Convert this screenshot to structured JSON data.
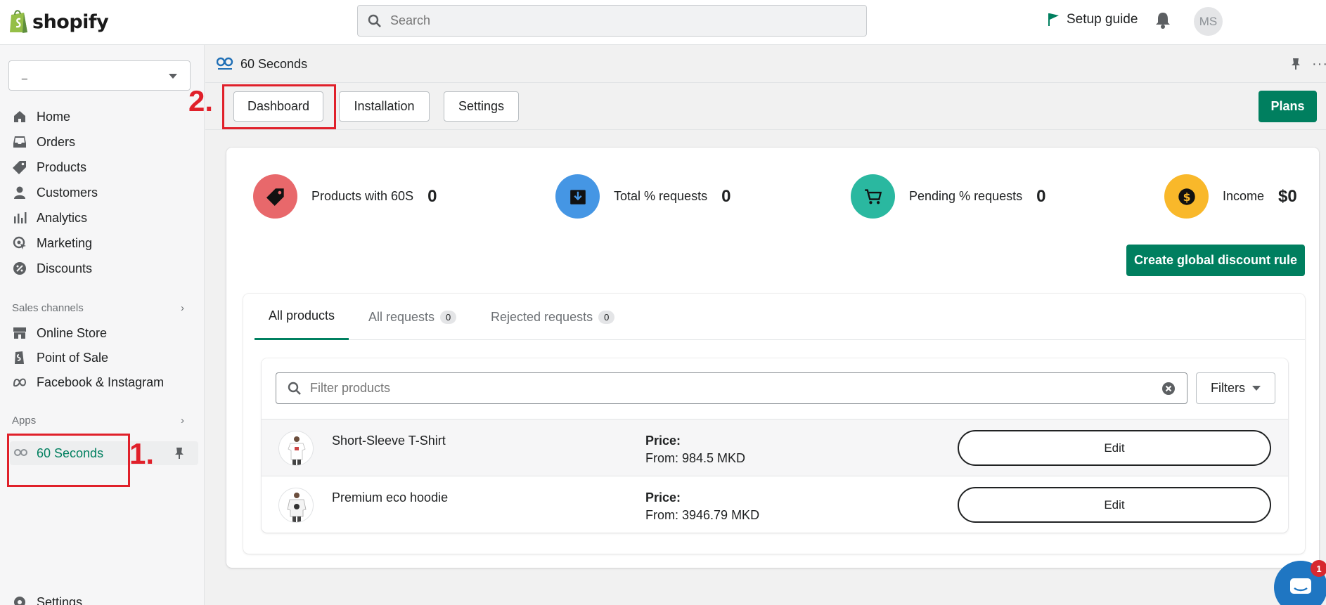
{
  "topbar": {
    "logo_text": "shopify",
    "search_placeholder": "Search",
    "setup_guide": "Setup guide",
    "avatar_initials": "MS"
  },
  "sidebar": {
    "store_name": "_",
    "items": [
      {
        "label": "Home",
        "icon": "home-icon"
      },
      {
        "label": "Orders",
        "icon": "inbox-icon"
      },
      {
        "label": "Products",
        "icon": "tag-icon"
      },
      {
        "label": "Customers",
        "icon": "person-icon"
      },
      {
        "label": "Analytics",
        "icon": "bar-chart-icon"
      },
      {
        "label": "Marketing",
        "icon": "target-icon"
      },
      {
        "label": "Discounts",
        "icon": "discount-icon"
      }
    ],
    "sales_channels_label": "Sales channels",
    "sales_channels": [
      {
        "label": "Online Store",
        "icon": "store-icon"
      },
      {
        "label": "Point of Sale",
        "icon": "pos-icon"
      },
      {
        "label": "Facebook & Instagram",
        "icon": "meta-icon"
      }
    ],
    "apps_label": "Apps",
    "active_app": "60 Seconds",
    "settings_label": "Settings"
  },
  "annotations": {
    "one": "1.",
    "two": "2."
  },
  "app": {
    "title": "60 Seconds",
    "tabs": [
      "Dashboard",
      "Installation",
      "Settings"
    ],
    "plans_label": "Plans"
  },
  "stats": [
    {
      "label": "Products with 60S",
      "value": "0",
      "color": "#e8686b",
      "icon": "tag-icon"
    },
    {
      "label": "Total % requests",
      "value": "0",
      "color": "#4596e4",
      "icon": "download-icon"
    },
    {
      "label": "Pending % requests",
      "value": "0",
      "color": "#2ab8a0",
      "icon": "cart-icon"
    },
    {
      "label": "Income",
      "value": "$0",
      "color": "#f9b82a",
      "icon": "dollar-icon"
    }
  ],
  "create_global_label": "Create global discount rule",
  "product_tabs": [
    {
      "label": "All products",
      "count": null
    },
    {
      "label": "All requests",
      "count": "0"
    },
    {
      "label": "Rejected requests",
      "count": "0"
    }
  ],
  "filter": {
    "placeholder": "Filter products",
    "filters_label": "Filters"
  },
  "products": [
    {
      "name": "Short-Sleeve T-Shirt",
      "price_label": "Price:",
      "price": "From: 984.5 MKD",
      "edit": "Edit"
    },
    {
      "name": "Premium eco hoodie",
      "price_label": "Price:",
      "price": "From: 3946.79 MKD",
      "edit": "Edit"
    }
  ],
  "chat_badge": "1"
}
